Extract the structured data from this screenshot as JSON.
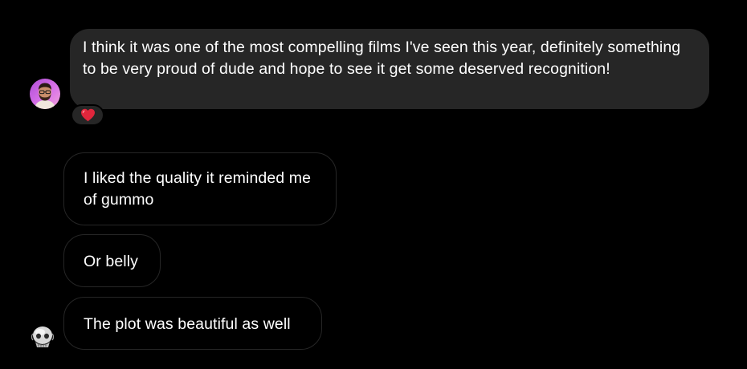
{
  "conversation": {
    "messages": [
      {
        "sender": "other",
        "text": "I think it was one of the most compelling films I've seen this year, definitely something to be very proud of dude and hope to see it get some deserved recognition!",
        "reaction": "red-heart"
      },
      {
        "sender": "self",
        "text": "I liked the quality it reminded me of gummo"
      },
      {
        "sender": "self",
        "text": "Or belly"
      },
      {
        "sender": "self",
        "text": "The plot was beautiful as well"
      }
    ]
  },
  "colors": {
    "background": "#000000",
    "incoming_bubble": "#262626",
    "outgoing_border": "#262626",
    "text": "#ffffff",
    "reaction_heart": "#e0263c"
  },
  "icons": {
    "avatar_1": "profile-photo-icon",
    "avatar_2": "profile-photo-icon",
    "reaction": "heart-icon"
  }
}
